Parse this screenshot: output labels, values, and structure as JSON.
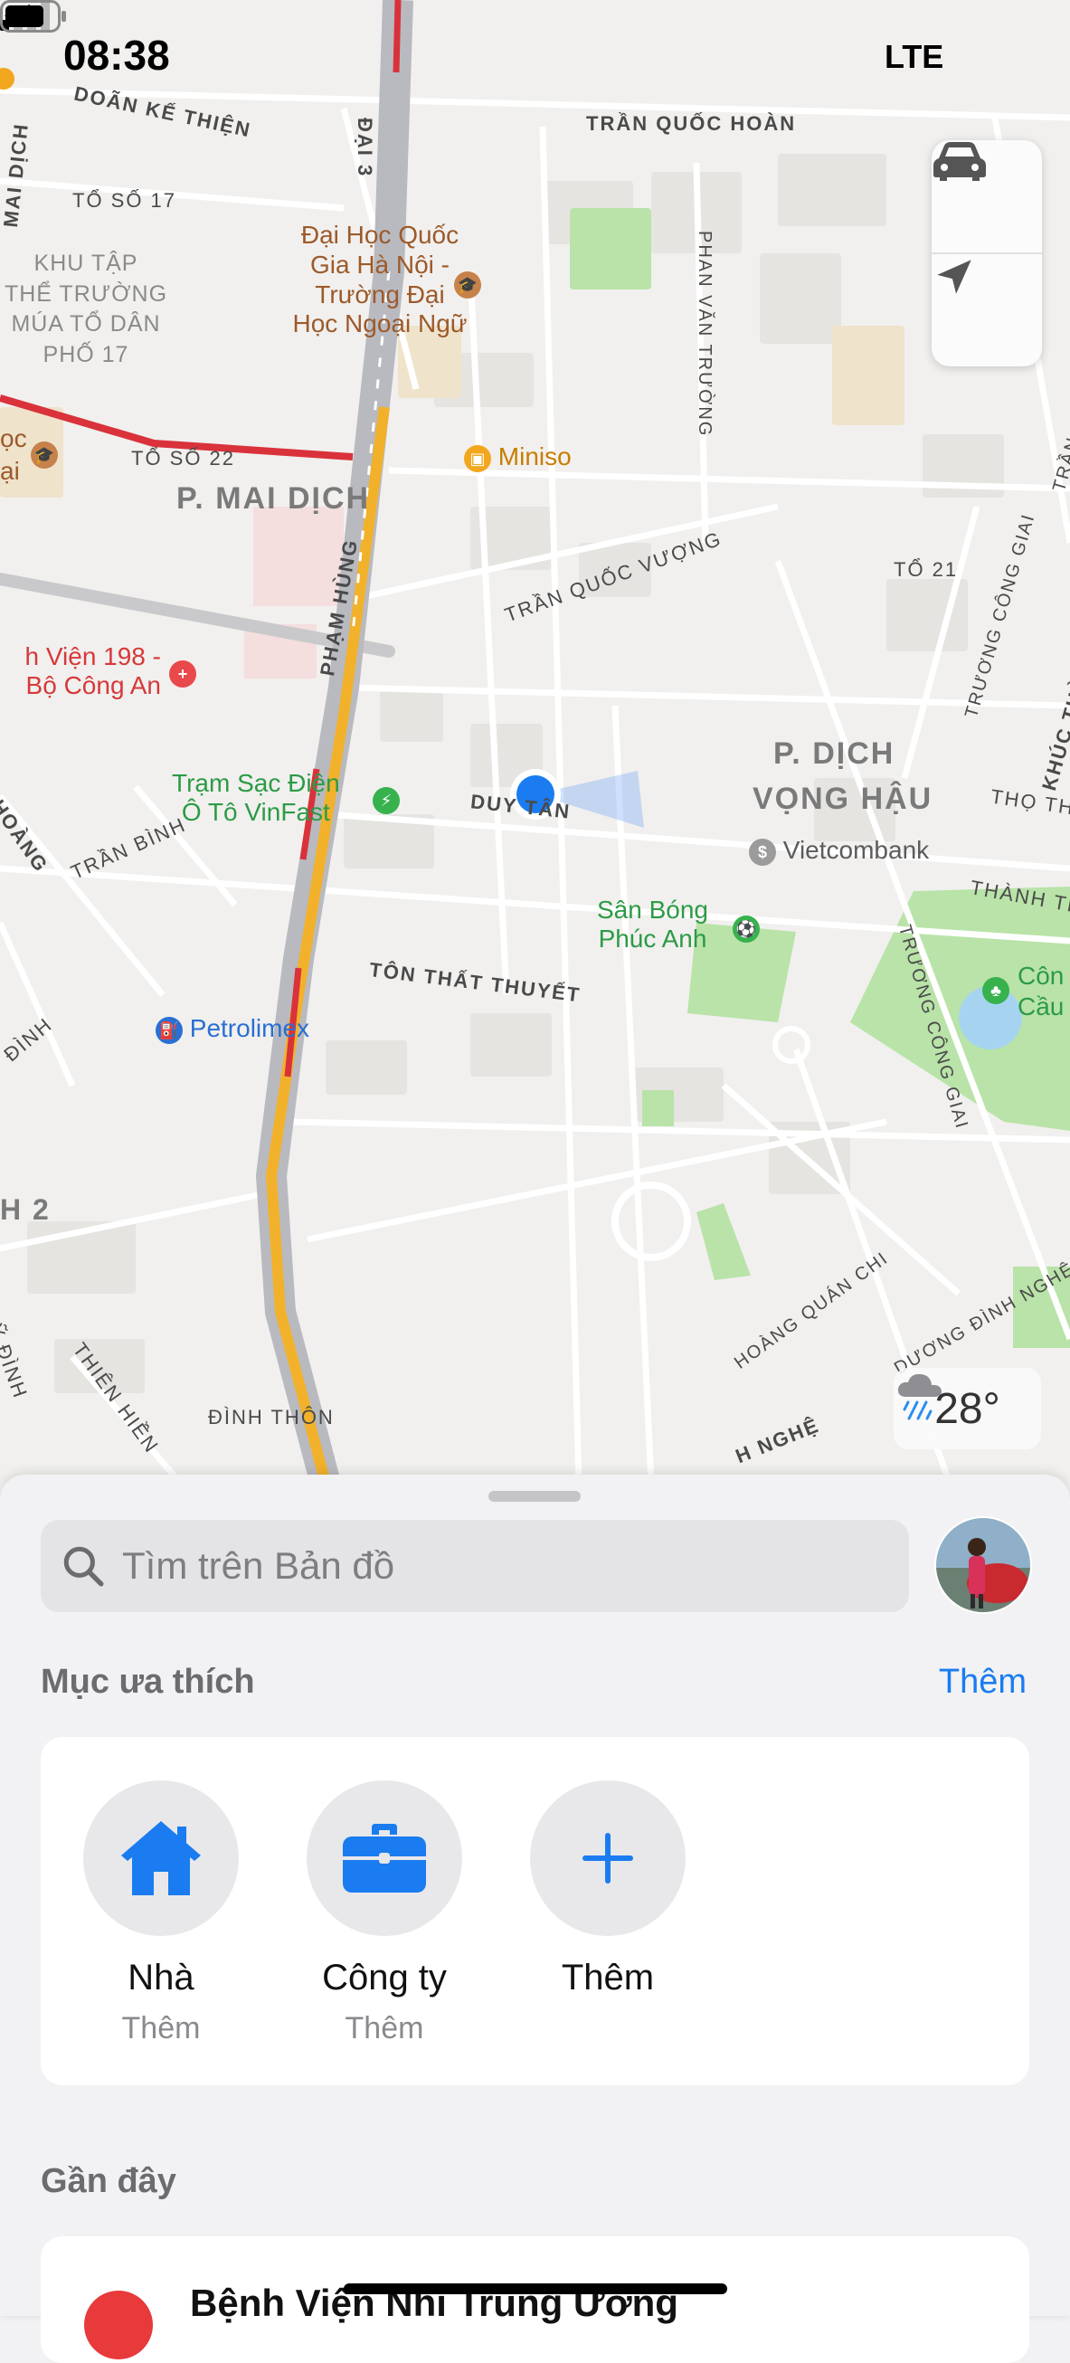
{
  "status_bar": {
    "time": "08:38",
    "network": "LTE"
  },
  "map": {
    "streets": {
      "doan_ke_thien": "DOÃN KẾ THIỆN",
      "tran_quoc_hoan": "TRẦN QUỐC HOÀN",
      "dai3": "ĐẠI 3",
      "to_so_17": "TỔ SỐ 17",
      "to_so_22": "TỔ SỐ 22",
      "mai_dich_left": "MAI DỊCH",
      "phan_van_truong": "PHAN VĂN TRƯỜNG",
      "tran_quy_kien": "TRẦN QUÝ KIÊN",
      "tran_quoc_vuong": "TRẦN QUỐC VƯỢNG",
      "pham_hung": "PHẠM HÙNG",
      "to_21": "TỔ 21",
      "truong_cong_giai_top": "TRƯƠNG CÔNG GIAI",
      "khuc_thua": "KHÚC THỪ",
      "tho_th": "THỌ TH",
      "duy_tan": "DUY TÂN",
      "tran_binh": "TRẦN BÌNH",
      "hoang_left": "HOÀNG",
      "thanh_th": "THÀNH TH",
      "ton_that_thuyet": "TÔN THẤT THUYẾT",
      "truong_cong_giai_bottom": "TRƯƠNG CÔNG GIAI",
      "dinh_left": "ĐÌNH",
      "h2": "H 2",
      "hoang_quan_chi": "HOÀNG QUÁN CHI",
      "duong_dinh_nghe": "DƯƠNG ĐÌNH NGHỆ",
      "thien_hien": "THIÊN HIỀN",
      "dinh_thon": "ĐÌNH THÔN",
      "ly_dinh": "Ỹ ĐÌNH",
      "h_nghe": "H NGHỆ"
    },
    "districts": {
      "mai_dich": "P. MAI DỊCH",
      "dich_vong_hau_1": "P. DỊCH",
      "dich_vong_hau_2": "VỌNG HẬU"
    },
    "areas": {
      "khu_tap_the": [
        "KHU TẬP",
        "THỂ TRƯỜNG",
        "MÚA TỔ DÂN",
        "PHỐ 17"
      ]
    },
    "pois": {
      "university": [
        "Đại Học Quốc",
        "Gia Hà Nội -",
        "Trường Đại",
        "Học Ngoại Ngữ"
      ],
      "university_left": [
        "ọc",
        "ại"
      ],
      "miniso": "Miniso",
      "hospital": [
        "h Viện 198 -",
        "Bộ Công An"
      ],
      "vinfast": [
        "Trạm Sạc Điện",
        "Ô Tô VinFast"
      ],
      "vietcombank": "Vietcombank",
      "football": [
        "Sân Bóng",
        "Phúc Anh"
      ],
      "park": [
        "Côn",
        "Cầu"
      ],
      "petrolimex": "Petrolimex"
    }
  },
  "weather": {
    "temp": "28°",
    "icon": "rain-cloud-icon"
  },
  "sheet": {
    "search_placeholder": "Tìm trên Bản đồ",
    "favorites_title": "Mục ưa thích",
    "favorites_more": "Thêm",
    "favorites": [
      {
        "label": "Nhà",
        "sub": "Thêm",
        "icon": "house-icon"
      },
      {
        "label": "Công ty",
        "sub": "Thêm",
        "icon": "briefcase-icon"
      },
      {
        "label": "Thêm",
        "sub": "",
        "icon": "plus-icon"
      }
    ],
    "recents_title": "Gần đây",
    "recents": [
      {
        "name": "Bệnh Viện Nhi Trung Ương"
      }
    ]
  },
  "colors": {
    "accent": "#1a7cf0",
    "highway": "#f2b12a",
    "traffic": "#d9323b"
  }
}
